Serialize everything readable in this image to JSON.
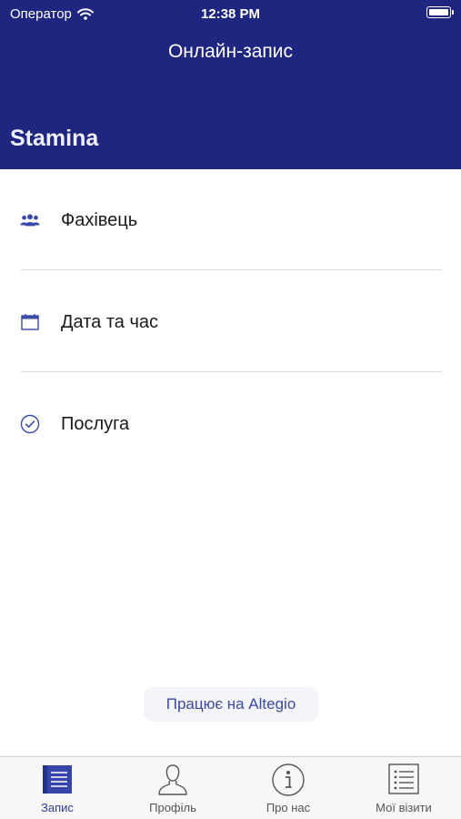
{
  "status_bar": {
    "carrier": "Оператор",
    "time": "12:38 PM"
  },
  "header": {
    "title": "Онлайн-запис",
    "large_title": "Stamina"
  },
  "menu": [
    {
      "label": "Фахівець",
      "icon": "people-icon"
    },
    {
      "label": "Дата та час",
      "icon": "calendar-icon"
    },
    {
      "label": "Послуга",
      "icon": "check-circle-icon"
    }
  ],
  "powered_by": "Працює на Altegio",
  "tabs": [
    {
      "label": "Запис",
      "icon": "book-icon",
      "active": true
    },
    {
      "label": "Профіль",
      "icon": "person-icon",
      "active": false
    },
    {
      "label": "Про нас",
      "icon": "info-icon",
      "active": false
    },
    {
      "label": "Мої візити",
      "icon": "list-icon",
      "active": false
    }
  ],
  "colors": {
    "header_bg": "#1f2680",
    "accent": "#3c4aa8",
    "tab_active": "#2d3b9b"
  }
}
